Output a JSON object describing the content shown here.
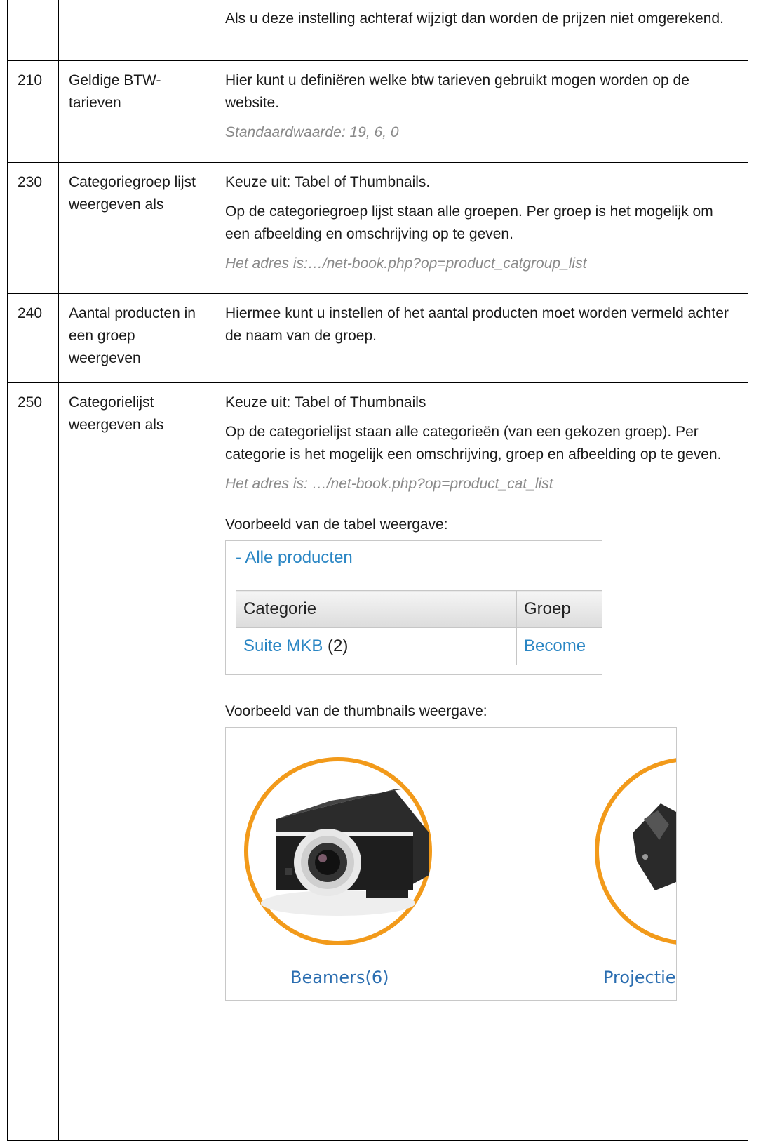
{
  "rows": [
    {
      "num": "",
      "name": "",
      "paragraphs": [
        "Als u deze instelling achteraf wijzigt dan worden de prijzen niet omgerekend."
      ]
    },
    {
      "num": "210",
      "name": "Geldige BTW-tarieven",
      "paragraphs": [
        "Hier kunt u definiëren welke btw tarieven gebruikt mogen worden op de website."
      ],
      "note": "Standaardwaarde: 19, 6, 0"
    },
    {
      "num": "230",
      "name": "Categoriegroep lijst weergeven als",
      "paragraphs": [
        "Keuze uit: Tabel of Thumbnails.",
        "Op de categoriegroep lijst staan alle groepen. Per groep is het mogelijk om een afbeelding en omschrijving op te geven."
      ],
      "note": "Het adres is:…/net-book.php?op=product_catgroup_list"
    },
    {
      "num": "240",
      "name": "Aantal producten in een groep weergeven",
      "paragraphs": [
        "Hiermee kunt u instellen of het aantal producten moet worden vermeld achter de naam van de groep."
      ]
    },
    {
      "num": "250",
      "name": "Categorielijst weergeven als",
      "paragraphs": [
        "Keuze uit: Tabel of Thumbnails",
        "Op de categorielijst staan alle categorieën (van een gekozen groep). Per categorie is het mogelijk een omschrijving, groep en afbeelding op te geven."
      ],
      "note": "Het adres is: …/net-book.php?op=product_cat_list",
      "table_example": {
        "caption": "Voorbeeld van de tabel weergave:",
        "link": "- Alle producten",
        "headers": [
          "Categorie",
          "Groep"
        ],
        "cell_link": "Suite MKB",
        "cell_count": " (2)",
        "cell_group": "Become"
      },
      "thumbs_example": {
        "caption": "Voorbeeld van de thumbnails weergave:",
        "labels": [
          "Beamers(6)",
          "Projectie"
        ]
      }
    }
  ],
  "colors": {
    "accent_orange": "#f29a1a",
    "link_blue": "#2a86c4",
    "note_gray": "#8a8a8a"
  }
}
